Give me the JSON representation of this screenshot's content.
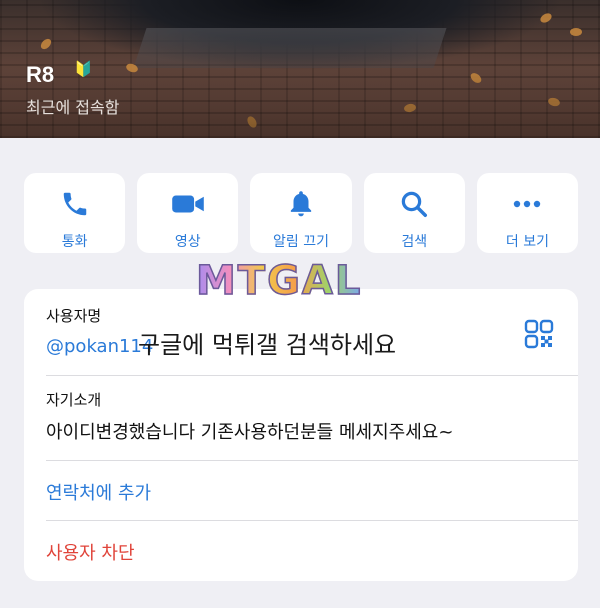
{
  "profile": {
    "name": "R8",
    "name_emoji": "🔰",
    "status": "최근에 접속함"
  },
  "actions": [
    {
      "id": "call",
      "label": "통화",
      "icon": "phone-icon"
    },
    {
      "id": "video",
      "label": "영상",
      "icon": "video-camera-icon"
    },
    {
      "id": "mute",
      "label": "알림 끄기",
      "icon": "bell-icon"
    },
    {
      "id": "search",
      "label": "검색",
      "icon": "search-icon"
    },
    {
      "id": "more",
      "label": "더 보기",
      "icon": "more-icon"
    }
  ],
  "info": {
    "username_label": "사용자명",
    "username_value": "@pokan114",
    "bio_label": "자기소개",
    "bio_value": "아이디변경했습니다 기존사용하던분들 메세지주세요~",
    "add_contact": "연락처에 추가",
    "block_user": "사용자 차단"
  },
  "overlay": {
    "logo_text": "MTGAL",
    "watermark_text": "구글에 먹튀갤 검색하세요"
  },
  "colors": {
    "accent": "#2a7ad8",
    "danger": "#e0443a",
    "background": "#efeff4"
  }
}
